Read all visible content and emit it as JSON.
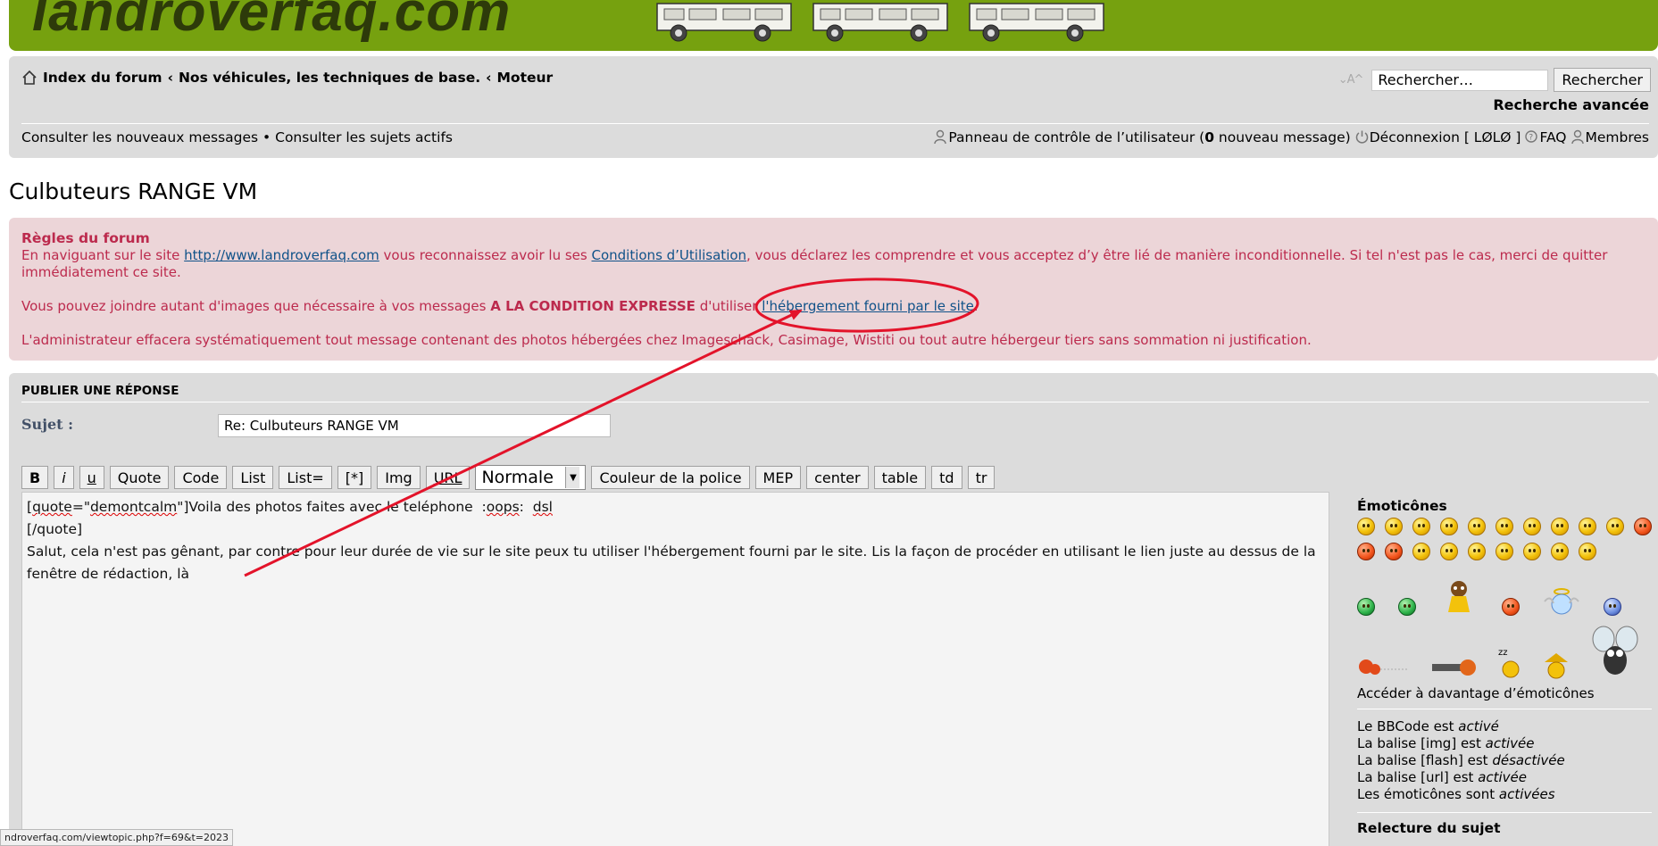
{
  "banner": {
    "logo_text": "landroverfaq.com"
  },
  "navbar": {
    "breadcrumbs": [
      "Index du forum",
      "Nos véhicules, les techniques de base.",
      "Moteur"
    ],
    "crumb_separator": "‹",
    "fontsize_glyph": "⌄A^",
    "search_placeholder": "Recherche",
    "search_value": "Rechercher…",
    "search_button": "Rechercher",
    "advanced_search": "Recherche avancée",
    "new_posts": "Consulter les nouveaux messages",
    "link_separator": "•",
    "active_topics": "Consulter les sujets actifs",
    "ucp_prefix": "Panneau de contrôle de l’utilisateur (",
    "ucp_count": "0",
    "ucp_suffix": " nouveau message)",
    "logout": "Déconnexion [ LØLØ ]",
    "faq": "FAQ",
    "members": "Membres"
  },
  "topic": {
    "title": "Culbuteurs RANGE VM"
  },
  "rules": {
    "title": "Règles du forum",
    "p1_a": "En naviguant sur le site ",
    "p1_link1": "http://www.landroverfaq.com",
    "p1_b": " vous reconnaissez avoir lu ses ",
    "p1_link2": "Conditions d’Utilisation",
    "p1_c": ", vous déclarez les comprendre et vous acceptez d’y être lié de manière inconditionnelle. Si tel n'est pas le cas, merci de quitter immédiatement ce site.",
    "p2_a": "Vous pouvez joindre autant d'images que nécessaire à vos messages ",
    "p2_strong": "A LA CONDITION EXPRESSE",
    "p2_b": " d'utiliser ",
    "p2_link": "l'hébergement fourni par le site",
    "p2_c": ".",
    "p3": "L'administrateur effacera systématiquement tout message contenant des photos hébergées chez Imageschack, Casimage, Wistiti ou tout autre hébergeur tiers sans sommation ni justification."
  },
  "form": {
    "title": "PUBLIER UNE RÉPONSE",
    "subject_label": "Sujet :",
    "subject_value": "Re: Culbuteurs RANGE VM",
    "toolbar": {
      "bold": "B",
      "italic": "i",
      "underline": "u",
      "quote": "Quote",
      "code": "Code",
      "list": "List",
      "list_eq": "List=",
      "list_item": "[*]",
      "img": "Img",
      "url": "URL",
      "size": "Normale",
      "color": "Couleur de la police",
      "mep": "MEP",
      "center": "center",
      "table": "table",
      "td": "td",
      "tr": "tr"
    },
    "editor": {
      "l1_a": "[",
      "l1_sp1": "quote",
      "l1_b": "=\"",
      "l1_sp2": "demontcalm",
      "l1_c": "\"]Voila des photos faites avec le teléphone  :",
      "l1_sp3": "oops",
      "l1_d": ":  ",
      "l1_sp4": "dsl",
      "l2": "[/quote]",
      "l3": "Salut, cela n'est pas gênant, par contre pour leur durée de vie sur le site peux tu utiliser l'hébergement fourni par le site. Lis la façon de procéder en utilisant le lien juste au dessus de la fenêtre de rédaction, là"
    }
  },
  "sidebar": {
    "title": "Émoticônes",
    "more": "Accéder à davantage d’émoticônes",
    "bbcode_a": "Le BBCode est ",
    "bbcode_b": "activé",
    "img_a": "La balise [img] est ",
    "img_b": "activée",
    "flash_a": "La balise [flash] est ",
    "flash_b": "désactivée",
    "url_a": "La balise [url] est ",
    "url_b": "activée",
    "smilies_a": "Les émoticônes sont ",
    "smilies_b": "activées",
    "review": "Relecture du sujet"
  },
  "statusbar": {
    "url": "ndroverfaq.com/viewtopic.php?f=69&t=2023"
  },
  "colors": {
    "banner": "#76a10f",
    "rules_bg": "#ecd5d8",
    "rules_text": "#bc2a4d",
    "panel": "#dcdcdc",
    "annotation": "#e3132a"
  }
}
